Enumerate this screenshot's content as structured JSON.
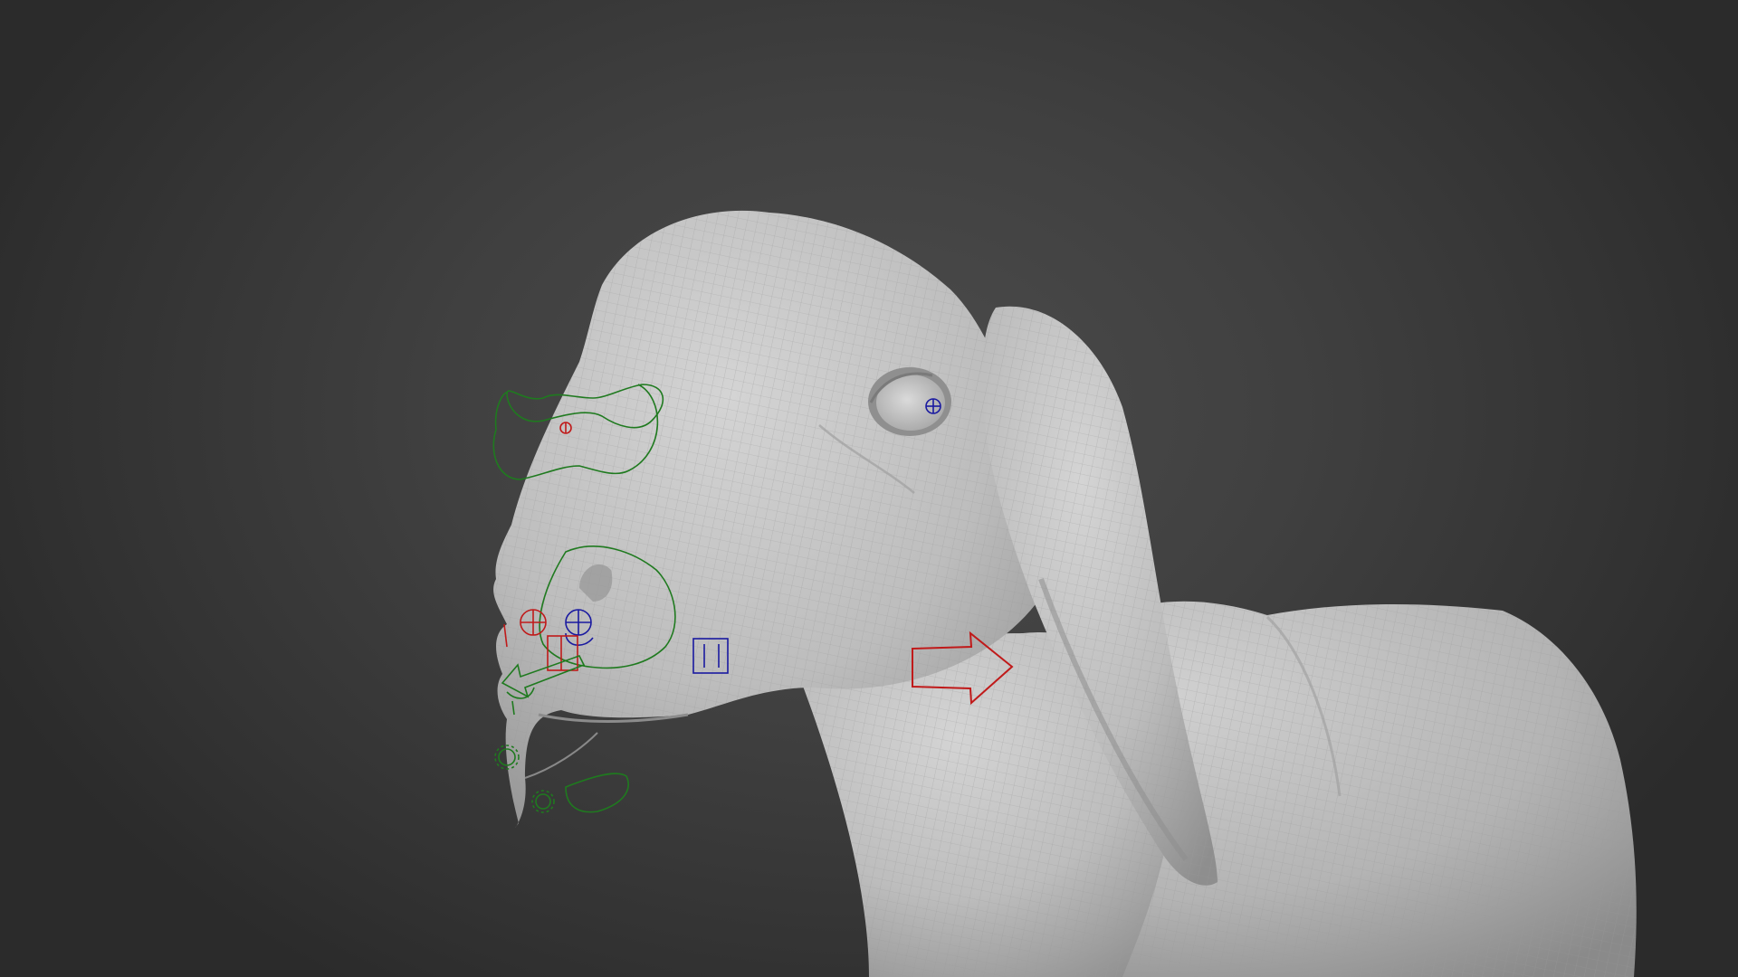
{
  "viewport": {
    "background_center": "#4c4c4c",
    "background_edge": "#2b2b2b"
  },
  "model": {
    "subject": "lamb",
    "shading": "solid",
    "wireframe_overlay": true,
    "surface_color": "#c9c9c9",
    "wire_color": "#9a9a9a"
  },
  "rig_controls": {
    "fk_color": "#1f7a1f",
    "left_color": "#c01a1a",
    "right_color": "#1a1aa0"
  }
}
